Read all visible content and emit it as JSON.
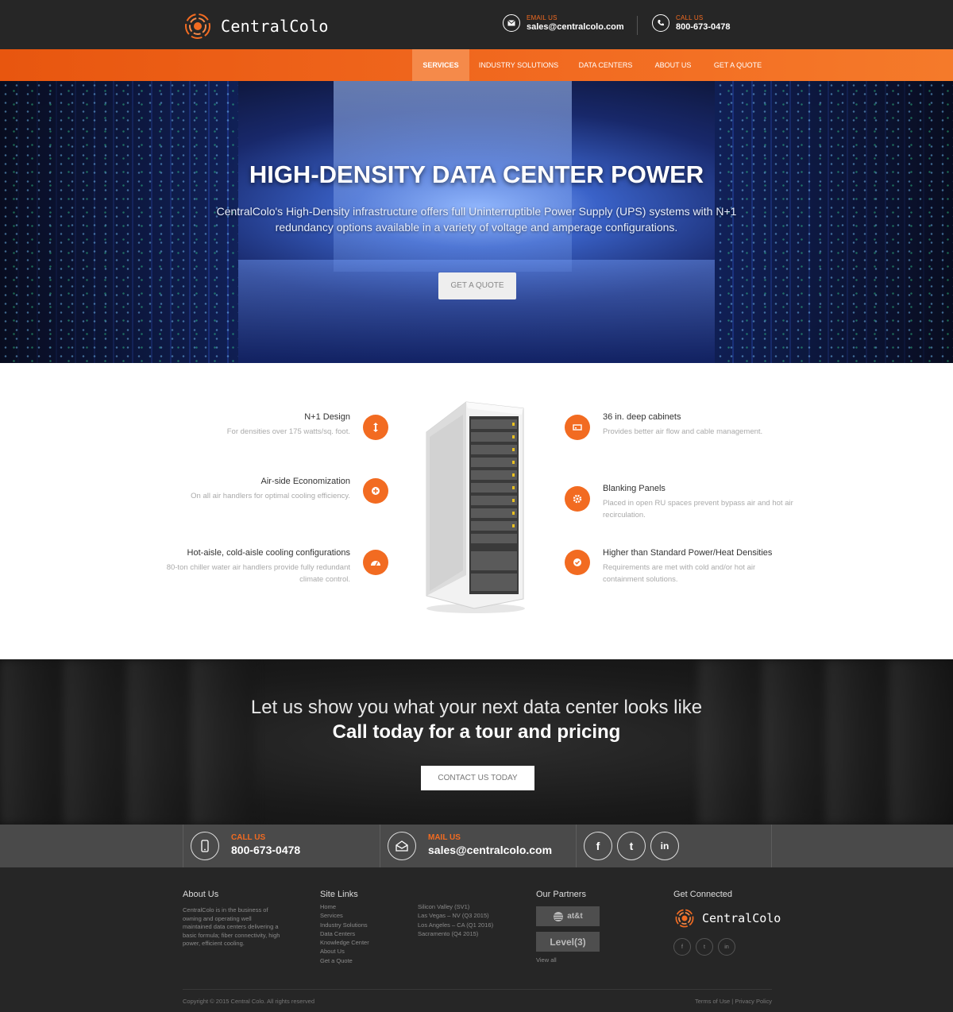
{
  "brand": {
    "name": "CentralColo",
    "accent_color": "#f26b21"
  },
  "header": {
    "email_label": "EMAIL US",
    "email_value": "sales@centralcolo.com",
    "call_label": "CALL US",
    "call_value": "800-673-0478"
  },
  "nav": {
    "items": [
      {
        "label": "SERVICES",
        "active": true
      },
      {
        "label": "INDUSTRY SOLUTIONS"
      },
      {
        "label": "DATA CENTERS"
      },
      {
        "label": "ABOUT US"
      },
      {
        "label": "GET A QUOTE"
      }
    ]
  },
  "hero": {
    "title": "HIGH-DENSITY DATA CENTER POWER",
    "subtitle": "CentralColo's High-Density infrastructure offers full Uninterruptible Power Supply (UPS) systems with N+1 redundancy options available in a variety of voltage and amperage configurations.",
    "button": "GET A QUOTE"
  },
  "features": {
    "left": [
      {
        "title": "N+1 Design",
        "text": "For densities over 175 watts/sq. foot.",
        "icon": "arrows-vertical-icon"
      },
      {
        "title": "Air-side Economization",
        "text": "On all air handlers for optimal cooling efficiency.",
        "icon": "plus-circle-icon"
      },
      {
        "title": "Hot-aisle, cold-aisle cooling configurations",
        "text": "80-ton chiller water air handlers provide fully redundant climate control.",
        "icon": "dashboard-icon"
      }
    ],
    "right": [
      {
        "title": "36 in. deep cabinets",
        "text": "Provides better air flow and cable management.",
        "icon": "hdd-icon"
      },
      {
        "title": "Blanking Panels",
        "text": "Placed in open RU spaces prevent bypass air and hot air recirculation.",
        "icon": "gear-icon"
      },
      {
        "title": "Higher than Standard Power/Heat Densities",
        "text": "Requirements are met with cold and/or hot air containment solutions.",
        "icon": "check-circle-icon"
      }
    ]
  },
  "cta": {
    "line1": "Let us show you what your next data center looks like",
    "line2": "Call today for a tour and pricing",
    "button": "CONTACT US TODAY"
  },
  "strip": {
    "call_label": "CALL US",
    "call_value": "800-673-0478",
    "mail_label": "MAIL US",
    "mail_value": "sales@centralcolo.com",
    "social": [
      "f",
      "t",
      "in"
    ]
  },
  "footer": {
    "about_title": "About Us",
    "about_text": "CentralColo is in the business of owning and operating well maintained data centers delivering a basic formula; fiber connectivity, high power, efficient cooling.",
    "sitelinks_title": "Site Links",
    "sitelinks": [
      "Home",
      "Services",
      "Industry Solutions",
      "Data Centers",
      "Knowledge Center",
      "About Us",
      "Get a Quote"
    ],
    "locations": [
      "Silicon Valley (SV1)",
      "Las Vegas – NV (Q3 2015)",
      "Los Angeles – CA (Q1 2016)",
      "Sacramento (Q4 2015)"
    ],
    "partners_title": "Our Partners",
    "partners": [
      "at&t",
      "Level(3)"
    ],
    "view_all": "View all",
    "connected_title": "Get Connected",
    "copyright": "Copyright © 2015 Central Colo. All rights reserved",
    "terms": "Terms of Use",
    "sep": "|",
    "privacy": "Privacy Policy"
  }
}
